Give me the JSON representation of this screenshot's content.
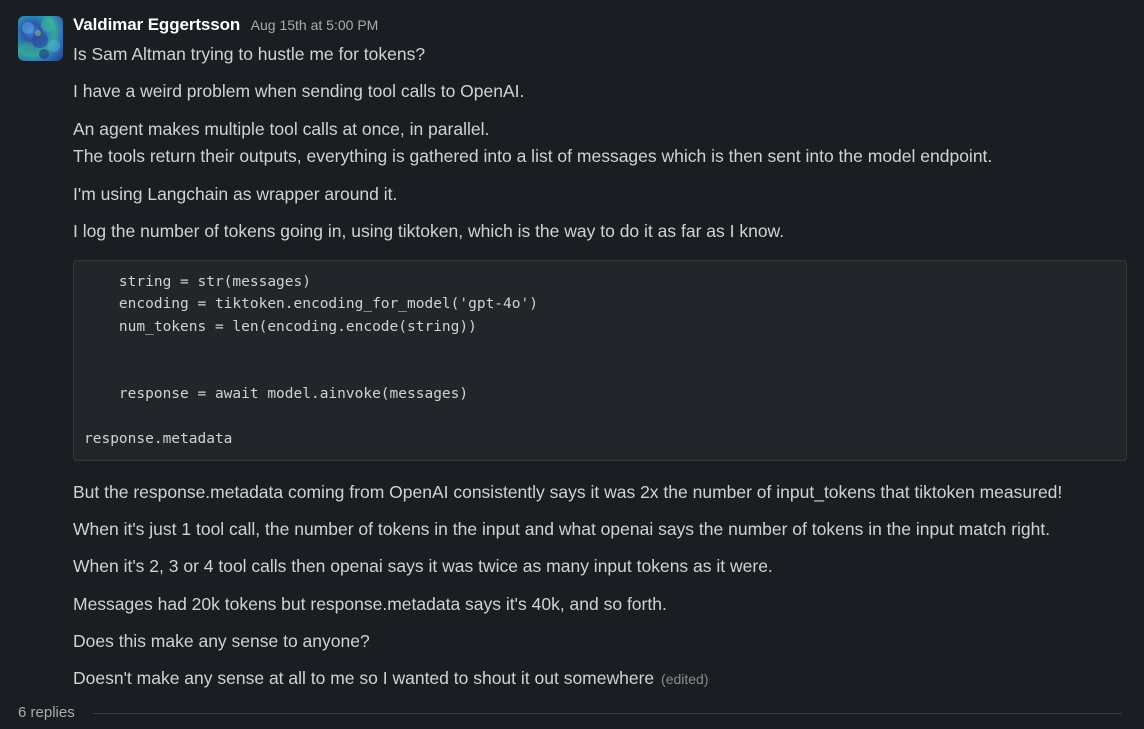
{
  "message": {
    "author": "Valdimar Eggertsson",
    "timestamp": "Aug 15th at 5:00 PM",
    "paragraphs_before_code": [
      "Is Sam Altman trying to hustle me for tokens?",
      "I have a weird problem when sending  tool calls to OpenAI.",
      "An agent makes multiple tool calls at once, in parallel.",
      "The tools return their outputs,  everything is gathered into a list of messages which is then sent into the model endpoint.",
      "I'm using Langchain as wrapper around it.",
      "I log the number of tokens going in, using tiktoken, which is the way to do it as far as I know."
    ],
    "code_lines": [
      "    string = str(messages)",
      "    encoding = tiktoken.encoding_for_model('gpt-4o')",
      "    num_tokens = len(encoding.encode(string))",
      "    response = await model.ainvoke(messages)",
      "response.metadata"
    ],
    "paragraphs_after_code": [
      "But the response.metadata coming from OpenAI consistently says it was 2x the number of input_tokens that tiktoken measured!",
      "When it's just 1 tool call,  the number of tokens in the input and what openai says the number of tokens in the input match right.",
      "When it's 2, 3 or 4 tool calls then openai says it was twice as many input tokens as it were.",
      "Messages had 20k tokens but response.metadata says it's 40k,  and so forth.",
      "Does this make any sense to anyone?",
      "Doesn't make any sense at all to me so I wanted to shout it out somewhere"
    ],
    "edited_label": "(edited)"
  },
  "thread": {
    "replies_label": "6 replies"
  },
  "colors": {
    "background": "#1a1d21",
    "text": "#d1d2d3",
    "author": "#ffffff",
    "muted": "#ababad",
    "code_background": "#222529"
  }
}
